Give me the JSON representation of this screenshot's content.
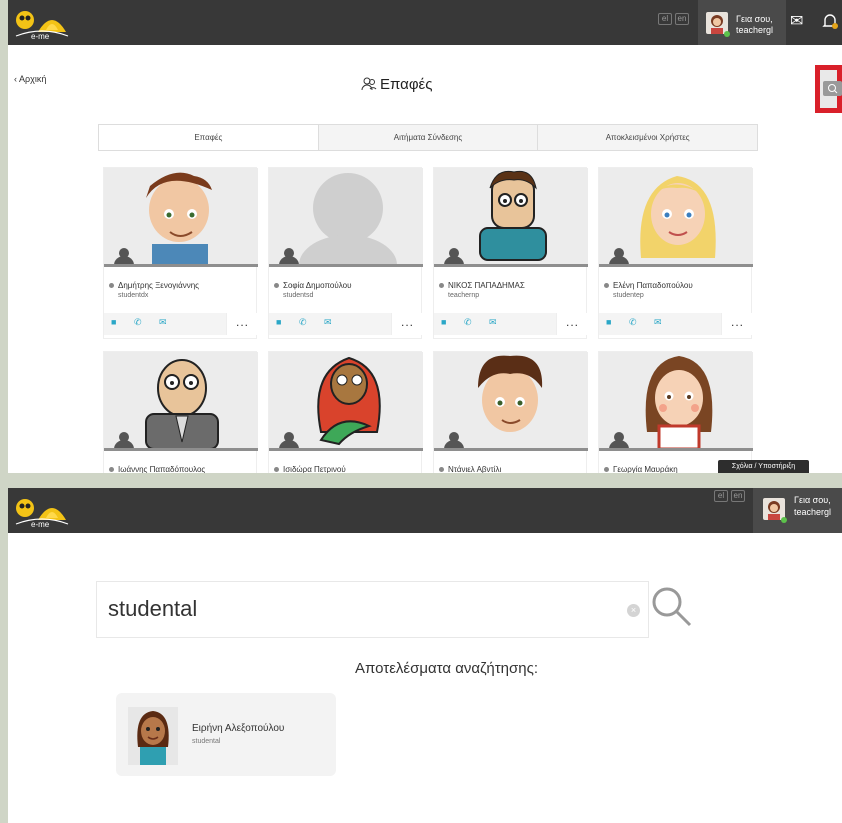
{
  "top": {
    "logo_text": "e-me",
    "lang_el": "el",
    "lang_en": "en",
    "greeting_line1": "Γεια σου,",
    "greeting_line2": "teachergl"
  },
  "page": {
    "back_label": "Αρχική",
    "title": "Επαφές"
  },
  "tabs": [
    {
      "label": "Επαφές",
      "active": true
    },
    {
      "label": "Αιτήματα Σύνδεσης",
      "active": false
    },
    {
      "label": "Αποκλεισμένοι Χρήστες",
      "active": false
    }
  ],
  "contacts": [
    {
      "name": "Δημήτρης Ξενογιάννης",
      "username": "studentdx"
    },
    {
      "name": "Σοφία Δημοπούλου",
      "username": "studentsd"
    },
    {
      "name": "ΝΙΚΟΣ ΠΑΠΑΔΗΜΑΣ",
      "username": "teachernp"
    },
    {
      "name": "Ελένη Παπαδοπούλου",
      "username": "studentep"
    },
    {
      "name": "Ιωάννης Παπαδόπουλος",
      "username": ""
    },
    {
      "name": "Ισιδώρα Πετρινού",
      "username": ""
    },
    {
      "name": "Ντάνιελ Αβντίλι",
      "username": ""
    },
    {
      "name": "Γεωργία Μαυράκη",
      "username": ""
    }
  ],
  "actions": {
    "more": "..."
  },
  "support_label": "Σχόλια / Υποστήριξη",
  "search": {
    "query": "studental",
    "clear_symbol": "×",
    "results_label": "Αποτελέσματα αναζήτησης:",
    "results": [
      {
        "name": "Ειρήνη Αλεξοπούλου",
        "username": "studental"
      }
    ]
  },
  "colors": {
    "topbar": "#383838",
    "accent": "#2aa7c7",
    "highlight": "#d9202a",
    "online": "#5cc24b"
  }
}
